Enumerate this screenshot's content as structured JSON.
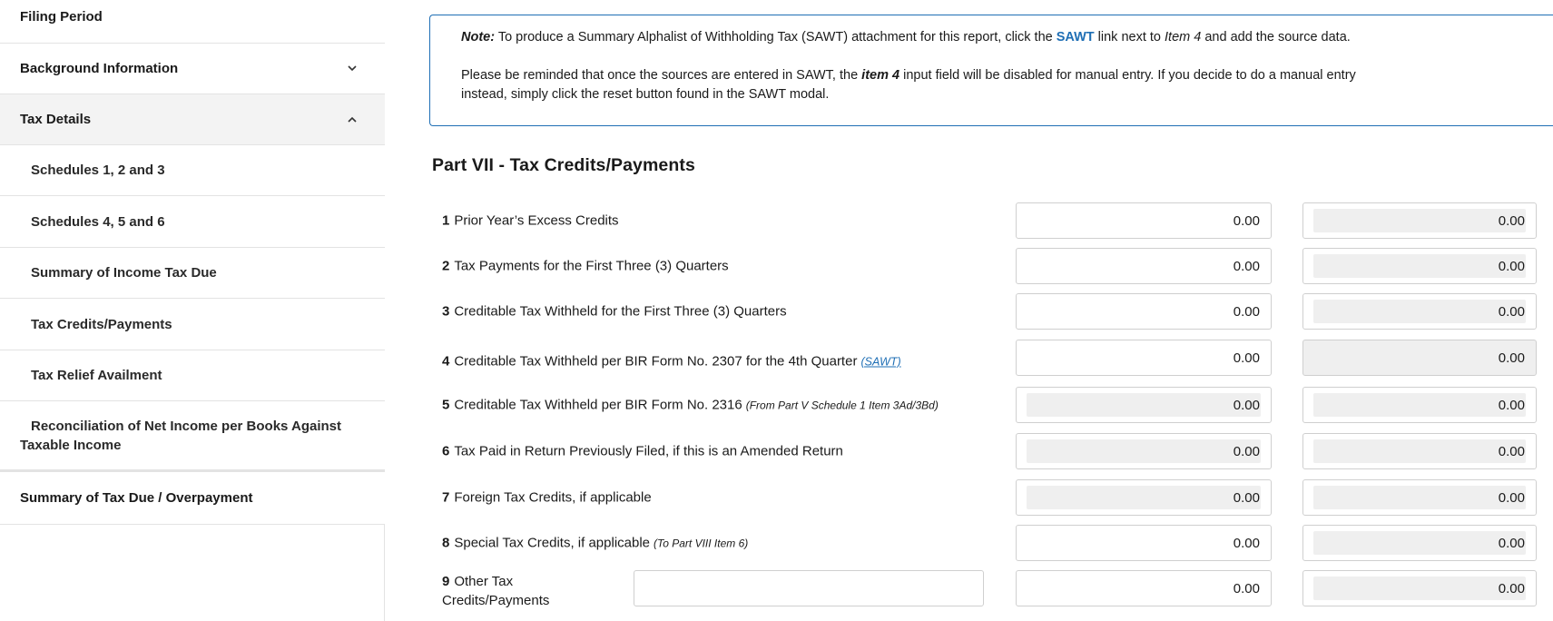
{
  "sidebar": {
    "filing_period": "Filing Period",
    "background_information": "Background Information",
    "tax_details": "Tax Details",
    "sub_items": [
      "Schedules 1, 2 and 3",
      "Schedules 4, 5 and 6",
      "Summary of Income Tax Due",
      "Tax Credits/Payments",
      "Tax Relief Availment",
      "Reconciliation of Net Income per Books Against Taxable Income"
    ],
    "summary_tax_due": "Summary of Tax Due / Overpayment"
  },
  "note": {
    "label": "Note:",
    "p1_a": "To produce a Summary Alphalist of Withholding Tax (SAWT) attachment for this report, click the",
    "p1_link": "SAWT",
    "p1_b": "link next to",
    "p1_item": "Item 4",
    "p1_c": "and add the source data.",
    "p2_a": "Please be reminded that once the sources are entered in SAWT, the",
    "p2_item": "item 4",
    "p2_b": "input field will be disabled for manual entry. If you decide to do a manual entry instead, simply click the reset button found in the SAWT modal."
  },
  "part_title": "Part VII - Tax Credits/Payments",
  "rows": [
    {
      "num": "1",
      "label": "Prior Year’s Excess Credits",
      "hint": "",
      "link": "",
      "col1": "0.00",
      "col2": "0.00"
    },
    {
      "num": "2",
      "label": "Tax Payments for the First Three (3) Quarters",
      "hint": "",
      "link": "",
      "col1": "0.00",
      "col2": "0.00"
    },
    {
      "num": "3",
      "label": "Creditable Tax Withheld for the First Three (3) Quarters",
      "hint": "",
      "link": "",
      "col1": "0.00",
      "col2": "0.00"
    },
    {
      "num": "4",
      "label": "Creditable Tax Withheld per BIR Form No. 2307 for the 4th Quarter",
      "hint": "",
      "link": "(SAWT)",
      "col1": "0.00",
      "col2": "0.00"
    },
    {
      "num": "5",
      "label": "Creditable Tax Withheld per BIR Form No. 2316",
      "hint": "(From Part V Schedule 1 Item 3Ad/3Bd)",
      "link": "",
      "col1": "0.00",
      "col2": "0.00"
    },
    {
      "num": "6",
      "label": "Tax Paid in Return Previously Filed, if this is an Amended Return",
      "hint": "",
      "link": "",
      "col1": "0.00",
      "col2": "0.00"
    },
    {
      "num": "7",
      "label": "Foreign Tax Credits, if applicable",
      "hint": "",
      "link": "",
      "col1": "0.00",
      "col2": "0.00"
    },
    {
      "num": "8",
      "label": "Special Tax Credits, if applicable",
      "hint": "(To Part VIII Item 6)",
      "link": "",
      "col1": "0.00",
      "col2": "0.00"
    },
    {
      "num": "9",
      "label": "Other Tax Credits/Payments",
      "hint": "",
      "link": "",
      "col1": "0.00",
      "col2": "0.00",
      "text_value": ""
    }
  ]
}
